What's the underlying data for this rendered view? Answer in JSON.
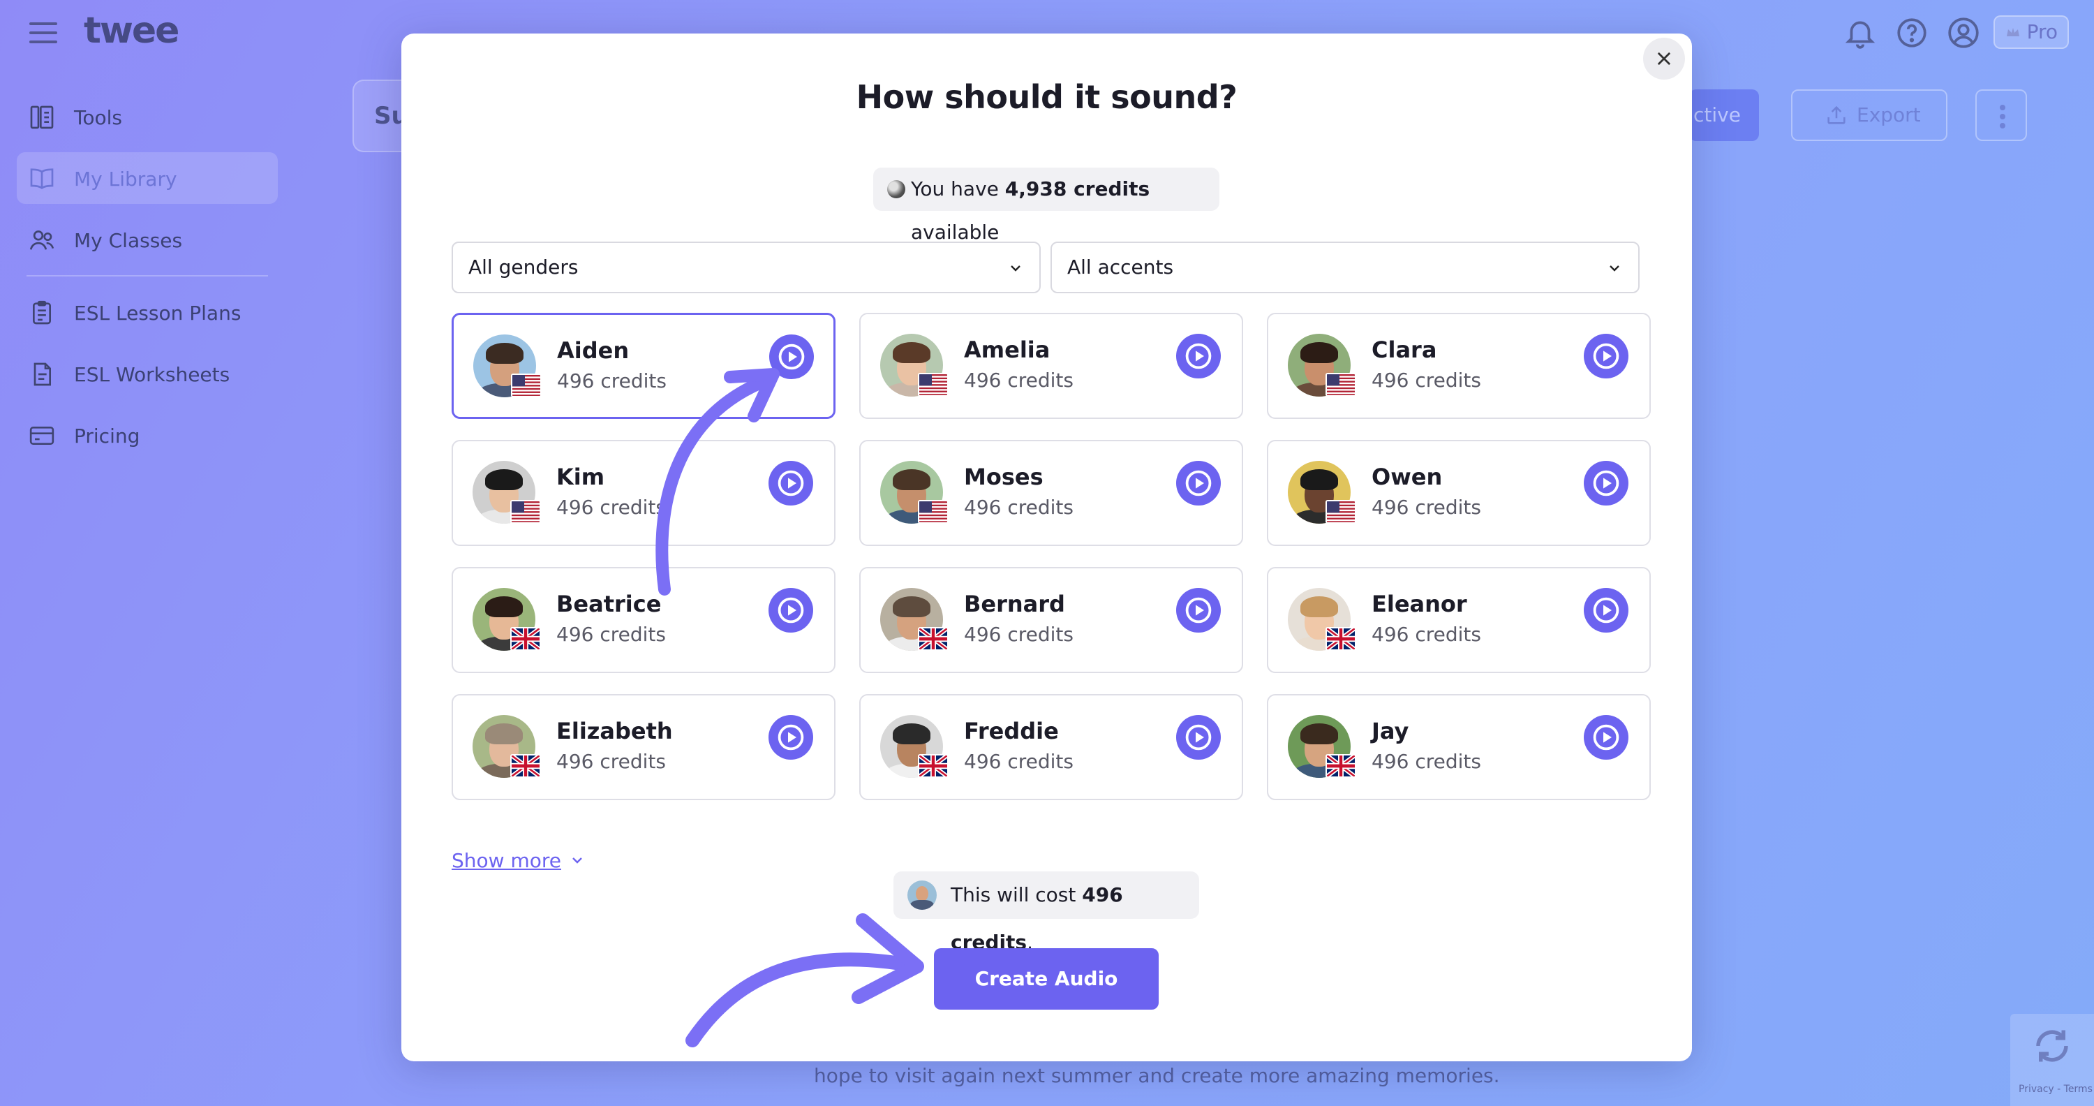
{
  "app": {
    "logo": "twee",
    "pro_label": "Pro"
  },
  "sidebar": {
    "items": [
      {
        "label": "Tools",
        "icon": "tools-icon"
      },
      {
        "label": "My Library",
        "icon": "book-icon"
      },
      {
        "label": "My Classes",
        "icon": "users-icon"
      },
      {
        "label": "ESL Lesson Plans",
        "icon": "clipboard-icon"
      },
      {
        "label": "ESL Worksheets",
        "icon": "worksheet-icon"
      },
      {
        "label": "Pricing",
        "icon": "card-icon"
      }
    ],
    "active_index": 1
  },
  "background": {
    "card_title": "Su",
    "active_button": "ctive",
    "export_button": "Export",
    "body_text": "hope to visit again next summer and create more amazing memories."
  },
  "modal": {
    "title": "How should it sound?",
    "credits": {
      "prefix": "You have ",
      "amount": "4,938 credits",
      "suffix": " available"
    },
    "filters": {
      "gender": "All genders",
      "accent": "All accents"
    },
    "voices": [
      {
        "name": "Aiden",
        "credits": "496 credits",
        "flag": "us",
        "selected": true
      },
      {
        "name": "Amelia",
        "credits": "496 credits",
        "flag": "us",
        "selected": false
      },
      {
        "name": "Clara",
        "credits": "496 credits",
        "flag": "us",
        "selected": false
      },
      {
        "name": "Kim",
        "credits": "496 credits",
        "flag": "us",
        "selected": false
      },
      {
        "name": "Moses",
        "credits": "496 credits",
        "flag": "us",
        "selected": false
      },
      {
        "name": "Owen",
        "credits": "496 credits",
        "flag": "us",
        "selected": false
      },
      {
        "name": "Beatrice",
        "credits": "496 credits",
        "flag": "uk",
        "selected": false
      },
      {
        "name": "Bernard",
        "credits": "496 credits",
        "flag": "uk",
        "selected": false
      },
      {
        "name": "Eleanor",
        "credits": "496 credits",
        "flag": "uk",
        "selected": false
      },
      {
        "name": "Elizabeth",
        "credits": "496 credits",
        "flag": "uk",
        "selected": false
      },
      {
        "name": "Freddie",
        "credits": "496 credits",
        "flag": "uk",
        "selected": false
      },
      {
        "name": "Jay",
        "credits": "496 credits",
        "flag": "uk",
        "selected": false
      }
    ],
    "show_more": "Show more",
    "cost": {
      "prefix": "This will cost ",
      "amount": "496 credits",
      "suffix": "."
    },
    "create_button": "Create Audio"
  },
  "colors": {
    "accent": "#6c63f0",
    "selected_border": "#6c63f0",
    "annotation_arrow": "#7b6ff5"
  },
  "recaptcha": {
    "footer": "Privacy - Terms"
  }
}
